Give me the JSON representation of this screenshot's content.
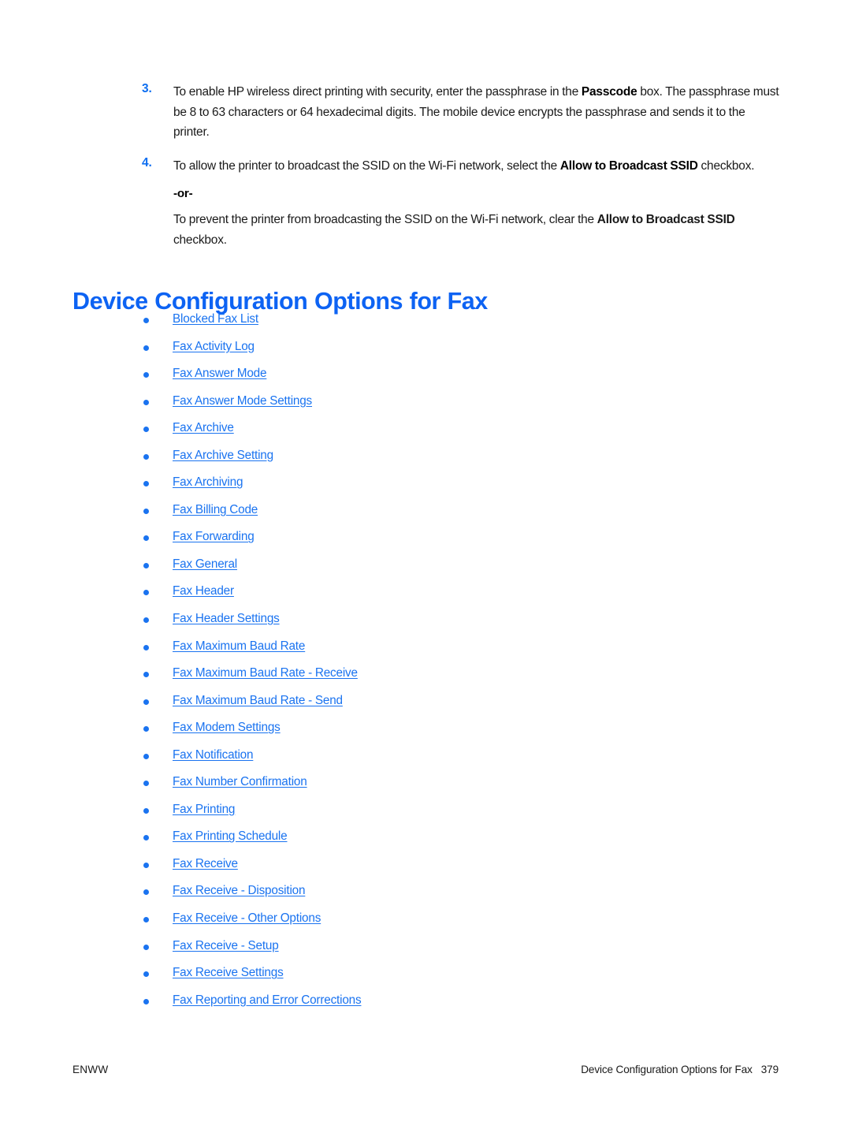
{
  "colors": {
    "heading_blue": "#0d63f3",
    "link_blue": "#1a73f0",
    "step_number_blue": "#0d6ef0",
    "body_text": "#1a1a1a",
    "page_background": "#ffffff"
  },
  "steps": [
    {
      "number": "3.",
      "segments": [
        {
          "text": "To enable HP wireless direct printing with security, enter the passphrase in the ",
          "bold": false
        },
        {
          "text": "Passcode",
          "bold": true
        },
        {
          "text": " box. The passphrase must be 8 to 63 characters or 64 hexadecimal digits. The mobile device encrypts the passphrase and sends it to the printer.",
          "bold": false
        }
      ]
    },
    {
      "number": "4.",
      "segments": [
        {
          "text": "To allow the printer to broadcast the SSID on the Wi-Fi network, select the ",
          "bold": false
        },
        {
          "text": "Allow to Broadcast SSID",
          "bold": true
        },
        {
          "text": " checkbox.",
          "bold": false
        }
      ]
    }
  ],
  "or_label": "-or-",
  "alternate_paragraph": [
    {
      "text": "To prevent the printer from broadcasting the SSID on the Wi-Fi network, clear the ",
      "bold": false
    },
    {
      "text": "Allow to Broadcast SSID",
      "bold": true
    },
    {
      "text": " checkbox.",
      "bold": false
    }
  ],
  "heading": "Device Configuration Options for Fax",
  "links": [
    "Blocked Fax List",
    "Fax Activity Log",
    "Fax Answer Mode",
    "Fax Answer Mode Settings",
    "Fax Archive",
    "Fax Archive Setting",
    "Fax Archiving",
    "Fax Billing Code",
    "Fax Forwarding",
    "Fax General",
    "Fax Header",
    "Fax Header Settings",
    "Fax Maximum Baud Rate",
    "Fax Maximum Baud Rate - Receive",
    "Fax Maximum Baud Rate - Send",
    "Fax Modem Settings",
    "Fax Notification",
    "Fax Number Confirmation",
    "Fax Printing",
    "Fax Printing Schedule",
    "Fax Receive",
    "Fax Receive - Disposition",
    "Fax Receive - Other Options",
    "Fax Receive - Setup",
    "Fax Receive Settings",
    "Fax Reporting and Error Corrections"
  ],
  "footer": {
    "left": "ENWW",
    "section_title": "Device Configuration Options for Fax",
    "page_number": "379"
  }
}
